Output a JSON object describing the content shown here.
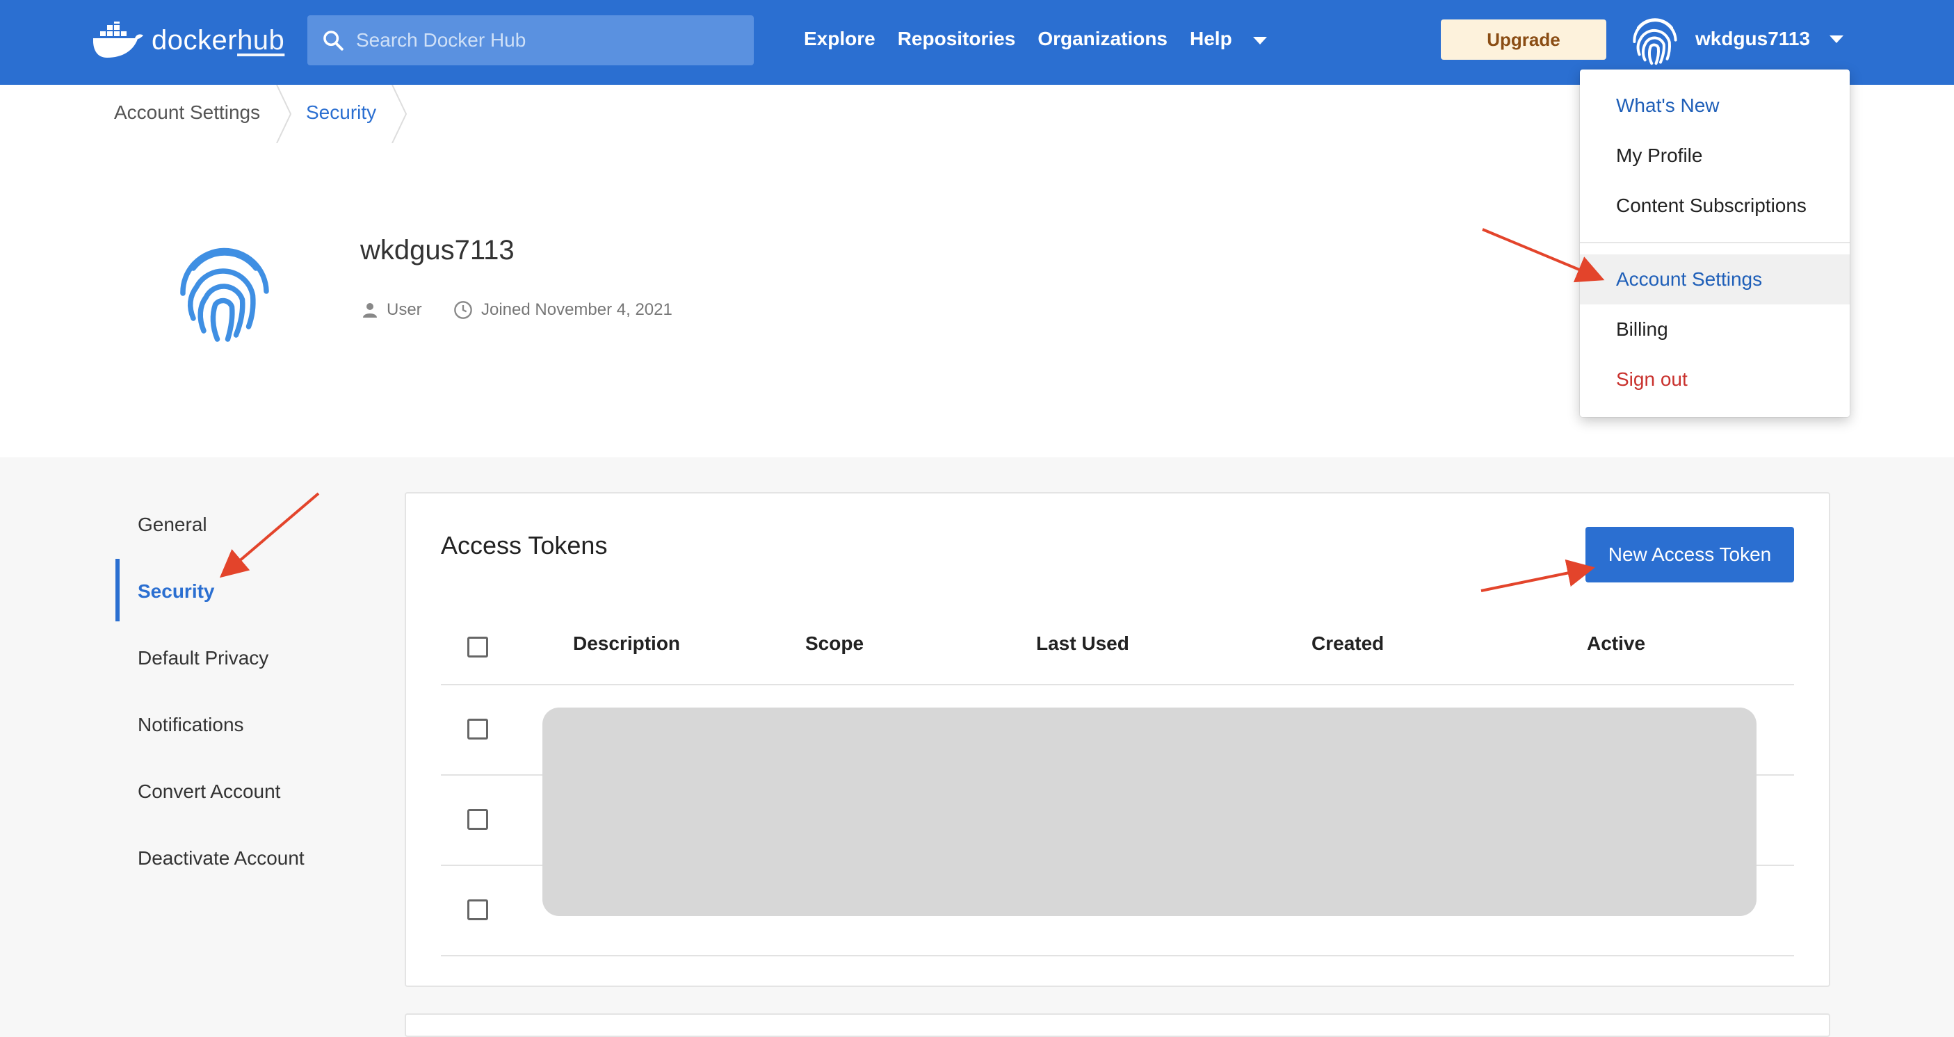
{
  "header": {
    "logo": {
      "docker": "docker",
      "hub": "hub"
    },
    "search": {
      "placeholder": "Search Docker Hub"
    },
    "nav": [
      {
        "label": "Explore"
      },
      {
        "label": "Repositories"
      },
      {
        "label": "Organizations"
      },
      {
        "label": "Help"
      }
    ],
    "upgrade_label": "Upgrade",
    "username": "wkdgus7113"
  },
  "breadcrumb": [
    "Account Settings",
    "Security"
  ],
  "profile": {
    "name": "wkdgus7113",
    "role": "User",
    "joined": "Joined November 4, 2021"
  },
  "sidebar": {
    "items": [
      {
        "label": "General",
        "active": false
      },
      {
        "label": "Security",
        "active": true
      },
      {
        "label": "Default Privacy",
        "active": false
      },
      {
        "label": "Notifications",
        "active": false
      },
      {
        "label": "Convert Account",
        "active": false
      },
      {
        "label": "Deactivate Account",
        "active": false
      }
    ]
  },
  "tokens": {
    "title": "Access Tokens",
    "new_button": "New Access Token",
    "columns": [
      "Description",
      "Scope",
      "Last Used",
      "Created",
      "Active"
    ],
    "row_count": 3
  },
  "user_menu": {
    "items": [
      {
        "label": "What's New"
      },
      {
        "label": "My Profile"
      },
      {
        "label": "Content Subscriptions"
      },
      {
        "label": "Account Settings"
      },
      {
        "label": "Billing"
      },
      {
        "label": "Sign out"
      }
    ]
  },
  "colors": {
    "brand": "#2b6fd1",
    "annotation_arrow": "#e3442b",
    "sign_out": "#c9312d"
  },
  "icons": [
    "docker-whale-icon",
    "search-icon",
    "fingerprint-avatar-icon",
    "user-icon",
    "clock-icon",
    "chevron-down-icon"
  ]
}
